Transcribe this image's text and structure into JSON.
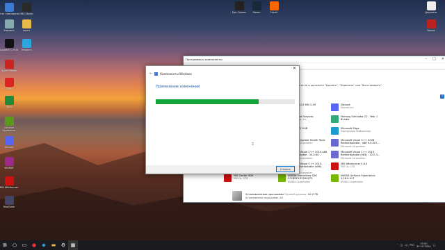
{
  "colors": {
    "progress": "#12a33a",
    "link": "#1e5fa8",
    "taskbar": "#1b1b1f"
  },
  "desktop_icons": [
    {
      "label": "Этот компьютер",
      "icon": "computer-icon",
      "color": "#3a7bd5"
    },
    {
      "label": "OBS Studio",
      "icon": "obs-icon",
      "color": "#2a2a2a"
    },
    {
      "label": "Корзина",
      "icon": "recycle-bin-icon",
      "color": "#8aa"
    },
    {
      "label": "пакет",
      "icon": "folder-icon",
      "color": "#e7b84a"
    },
    {
      "label": "Logitech G HUB",
      "icon": "logitech-icon",
      "color": "#111"
    },
    {
      "label": "Telegram",
      "icon": "telegram-icon",
      "color": "#2ca5e0"
    },
    {
      "label": "Ryzen Master",
      "icon": "ryzen-icon",
      "color": "#c22"
    },
    {
      "label": "Opera",
      "icon": "opera-icon",
      "color": "#d22"
    },
    {
      "label": "Xbox",
      "icon": "xbox-icon",
      "color": "#1e8c3a"
    },
    {
      "label": "GeForce Experience",
      "icon": "geforce-icon",
      "color": "#5a9a1a"
    },
    {
      "label": "Discord",
      "icon": "discord-icon",
      "color": "#5865f2"
    },
    {
      "label": "WinRAR",
      "icon": "winrar-icon",
      "color": "#9b2a8a"
    },
    {
      "label": "MSI Afterburner",
      "icon": "msi-icon",
      "color": "#c11"
    },
    {
      "label": "RivaTuner",
      "icon": "rivatuner-icon",
      "color": "#446"
    },
    {
      "label": "Epic Games",
      "icon": "epic-icon",
      "color": "#222"
    },
    {
      "label": "Steam",
      "icon": "steam-icon",
      "color": "#1b2838"
    },
    {
      "label": "Faceit",
      "icon": "faceit-icon",
      "color": "#f60"
    },
    {
      "label": "Документ",
      "icon": "document-icon",
      "color": "#eee"
    },
    {
      "label": "Ярлык",
      "icon": "shortcut-icon",
      "color": "#b22"
    }
  ],
  "programs_window": {
    "title": "Программы и компоненты",
    "address": "Программы и компоненты",
    "tip": "ите ее и щелкните \"Удалить\", \"Изменить\" или \"Восстановить\".",
    "items": [
      {
        "name": "Lunar Strike 2",
        "publisher": "",
        "color": "#4a6",
        "icon": "app-icon"
      },
      {
        "name": "CPUID CPU-Z MSI 2.09",
        "publisher": "CPUID, Inc.",
        "color": "#7a1a1a",
        "icon": "cpuz-icon"
      },
      {
        "name": "Discord",
        "publisher": "Discord Inc.",
        "color": "#5865f2",
        "icon": "discord-icon"
      },
      {
        "name": "Epic Games Launcher",
        "publisher": "Epic Games, Inc.",
        "color": "#333",
        "icon": "epic-icon"
      },
      {
        "name": "Epic Online Services",
        "publisher": "Epic Games, Inc.",
        "color": "#222",
        "icon": "epic-icon"
      },
      {
        "name": "Farming Simulator 22 - Year 1 Bundle",
        "publisher": "",
        "color": "#3a7",
        "icon": "game-icon"
      },
      {
        "name": "Intel(R) Chipset Device Software",
        "publisher": "Intel Corporation",
        "color": "#2a6cc4",
        "icon": "intel-icon"
      },
      {
        "name": "Logitech G HUB",
        "publisher": "Logitech",
        "color": "#111",
        "icon": "logitech-icon"
      },
      {
        "name": "Microsoft Edge",
        "publisher": "Корпорация Майкрософт",
        "color": "#1a9bd0",
        "icon": "edge-icon"
      },
      {
        "name": "Microsoft OneDrive",
        "publisher": "Microsoft Corporation",
        "color": "#1e6fd0",
        "icon": "onedrive-icon"
      },
      {
        "name": "Microsoft Update Health Tools",
        "publisher": "Microsoft Corporation",
        "color": "#5a8ad0",
        "icon": "update-icon"
      },
      {
        "name": "Microsoft Visual C++ 2008 Redistributable - x86 9.0.307...",
        "publisher": "Microsoft Corporation",
        "color": "#6a6ad0",
        "icon": "vcpp-icon"
      },
      {
        "name": "Microsoft Visual C++ 2010 x64 Redistributable - 10.0.40...",
        "publisher": "Microsoft Corporation",
        "color": "#6a6ad0",
        "icon": "vcpp-icon"
      },
      {
        "name": "Microsoft Visual C++ 2010 x86 Redistributable - 10.0.40...",
        "publisher": "Microsoft Corporation",
        "color": "#6a6ad0",
        "icon": "vcpp-icon"
      },
      {
        "name": "Microsoft Visual C++ 2013 Redistributable (x64) - 12.0.3...",
        "publisher": "Microsoft Corporation",
        "color": "#6a6ad0",
        "icon": "vcpp-icon"
      },
      {
        "name": "Microsoft Visual C++ 2015-2022 Redistributable (x64) - 14...",
        "publisher": "Microsoft Corporation",
        "color": "#6a6ad0",
        "icon": "vcpp-icon"
      },
      {
        "name": "Microsoft Visual C++ 2015-2022 Redistributable (x86) - 14...",
        "publisher": "Microsoft Corporation",
        "color": "#6a6ad0",
        "icon": "vcpp-icon"
      },
      {
        "name": "MSI Afterburner 4.6.5",
        "publisher": "MSI Co., LTD",
        "color": "#c11",
        "icon": "msi-icon"
      },
      {
        "name": "MSI Center SDK",
        "publisher": "MSI Co., LTD",
        "color": "#c11",
        "icon": "msi-icon"
      },
      {
        "name": "NVIDIA FrameView SDK 1.3.8513.32290073",
        "publisher": "NVIDIA Corporation",
        "color": "#76b900",
        "icon": "nvidia-icon"
      },
      {
        "name": "NVIDIA GeForce Experience 3.28.0.417",
        "publisher": "NVIDIA Corporation",
        "color": "#76b900",
        "icon": "nvidia-icon"
      }
    ],
    "status_title": "Установленные программы",
    "status_size_label": "Полный размер:",
    "status_size": "42,2 ГБ",
    "status_count": "Установлено программ: 46"
  },
  "dialog": {
    "title": "Компоненты Windows",
    "message": "Применение изменений",
    "progress": 0.74,
    "button": "Отмена"
  },
  "taskbar": {
    "language": "РУС",
    "time": "19:00",
    "date": "30.10.2024"
  }
}
